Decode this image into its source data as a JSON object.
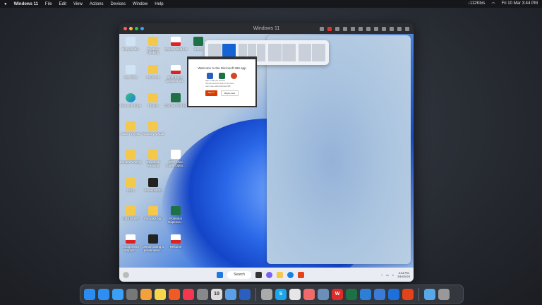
{
  "menubar": {
    "apple": "",
    "app": "Windows 11",
    "items": [
      "File",
      "Edit",
      "View",
      "Actions",
      "Devices",
      "Window",
      "Help"
    ],
    "net": "↓112Kb/s",
    "datetime": "Fri 10 Mar  3:44 PM"
  },
  "vm": {
    "title": "Windows 11"
  },
  "desktop_icons": [
    {
      "label": "Recycle Bin",
      "kind": "bin"
    },
    {
      "label": "Rootbay Desktop",
      "kind": "folder"
    },
    {
      "label": "Carbon Shift list",
      "kind": "pdf"
    },
    {
      "label": "Excel",
      "kind": "xl"
    },
    {
      "label": "Mac Files",
      "kind": "bin"
    },
    {
      "label": "Pdf Work",
      "kind": "folder"
    },
    {
      "label": "Shift Docs - Dropbox Sh...",
      "kind": "pdf"
    },
    {
      "label": "Microsoft Edge",
      "kind": "edge"
    },
    {
      "label": "Photos",
      "kind": "folder"
    },
    {
      "label": "Carbon Shift list",
      "kind": "xl"
    },
    {
      "label": "Audio Projects",
      "kind": "folder"
    },
    {
      "label": "Rootbay Visual",
      "kind": "folder"
    },
    {
      "label": "Content Writing",
      "kind": "folder"
    },
    {
      "label": "Research Reading",
      "kind": "folder"
    },
    {
      "label": "EPC User Guide Optio...",
      "kind": "doc"
    },
    {
      "label": "Docs",
      "kind": "folder"
    },
    {
      "label": "Screenshots",
      "kind": "dark"
    },
    {
      "label": "GitHubFiles",
      "kind": "folder"
    },
    {
      "label": "Focusky app",
      "kind": "folder"
    },
    {
      "label": "Potential Expense...",
      "kind": "xl"
    },
    {
      "label": "Assignment Report...",
      "kind": "pdf"
    },
    {
      "label": "person doing a presentatio...",
      "kind": "dark"
    },
    {
      "label": "Resume",
      "kind": "pdf"
    }
  ],
  "dialog": {
    "heading": "Welcome to the Microsoft 365 app",
    "options": [
      "Sign in with your account",
      "Open documents stored in the cloud",
      "Learn more about Microsoft 365"
    ],
    "primary": "Sign in",
    "secondary": "Maybe later"
  },
  "taskbar": {
    "search": "Search",
    "time": "3:44 PM",
    "date": "3/10/2023"
  },
  "dock": [
    {
      "name": "finder",
      "color": "#2a8cf0"
    },
    {
      "name": "safari",
      "color": "#2f8ef2"
    },
    {
      "name": "mail",
      "color": "#3aa0f5"
    },
    {
      "name": "launchpad",
      "color": "#777"
    },
    {
      "name": "photos",
      "color": "#f3a23b"
    },
    {
      "name": "notes",
      "color": "#f7d64c"
    },
    {
      "name": "brave",
      "color": "#f05a24"
    },
    {
      "name": "music",
      "color": "#f5364f"
    },
    {
      "name": "settings",
      "color": "#888"
    },
    {
      "name": "calendar",
      "color": "#ddd",
      "text": "10"
    },
    {
      "name": "freeform",
      "color": "#5aa0e8"
    },
    {
      "name": "word",
      "color": "#2b5fbd"
    },
    {
      "sep": true
    },
    {
      "name": "parallels",
      "color": "#aaa"
    },
    {
      "name": "skype",
      "color": "#1aa6ee",
      "text": "S"
    },
    {
      "name": "slack",
      "color": "#e6e6e6"
    },
    {
      "name": "asana",
      "color": "#f06a6a"
    },
    {
      "name": "preview",
      "color": "#6b8fb8"
    },
    {
      "name": "wps",
      "color": "#e02b2b",
      "text": "W"
    },
    {
      "name": "excel",
      "color": "#1e7145"
    },
    {
      "name": "remote",
      "color": "#2d7fd6"
    },
    {
      "name": "windows-app",
      "color": "#3a7bd5"
    },
    {
      "name": "windows",
      "color": "#1e6fd9"
    },
    {
      "name": "office",
      "color": "#e3421b"
    },
    {
      "sep": true
    },
    {
      "name": "downloads",
      "color": "#56a8e8"
    },
    {
      "name": "trash",
      "color": "#999"
    }
  ]
}
